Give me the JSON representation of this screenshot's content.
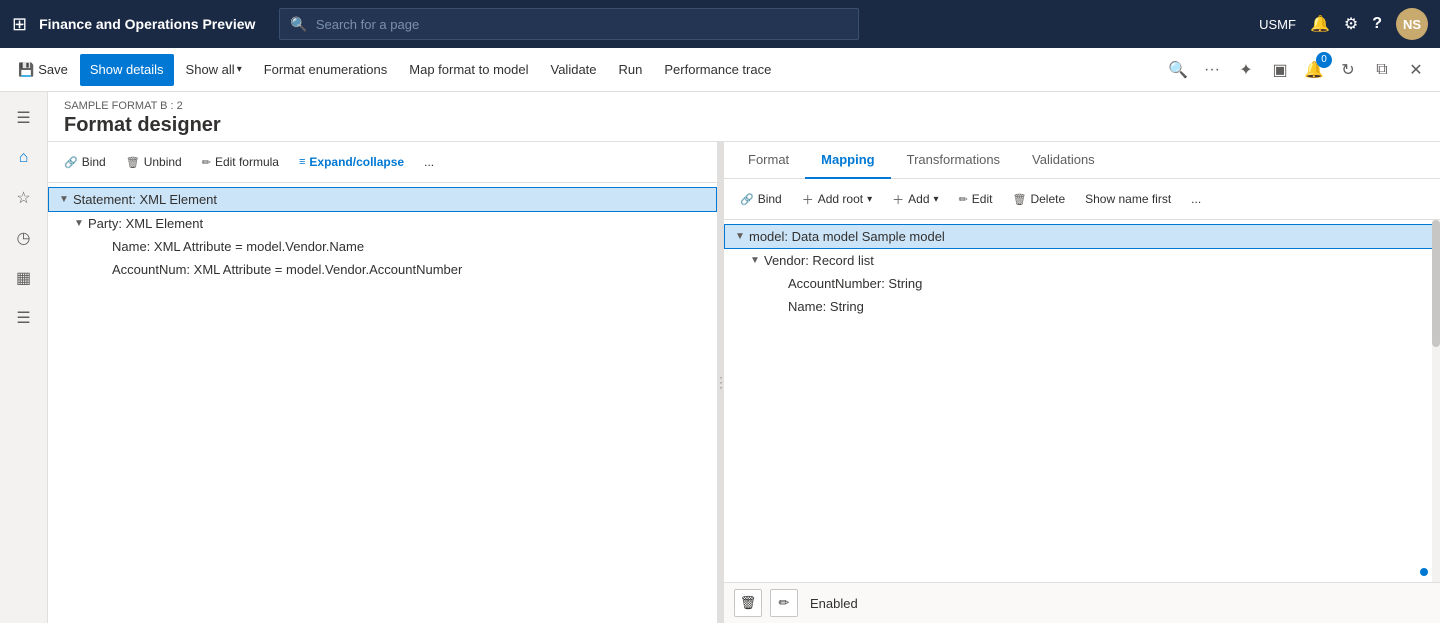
{
  "topnav": {
    "app_title": "Finance and Operations Preview",
    "search_placeholder": "Search for a page",
    "org": "USMF"
  },
  "commandbar": {
    "save_label": "Save",
    "show_details_label": "Show details",
    "show_all_label": "Show all",
    "format_enumerations_label": "Format enumerations",
    "map_format_label": "Map format to model",
    "validate_label": "Validate",
    "run_label": "Run",
    "performance_trace_label": "Performance trace"
  },
  "page": {
    "breadcrumb": "SAMPLE FORMAT B : 2",
    "title": "Format designer"
  },
  "left_pane": {
    "toolbar": {
      "bind_label": "Bind",
      "unbind_label": "Unbind",
      "edit_formula_label": "Edit formula",
      "expand_collapse_label": "Expand/collapse",
      "more_label": "..."
    },
    "tree": [
      {
        "id": "statement",
        "label": "Statement: XML Element",
        "indent": 0,
        "chevron": "▼",
        "selected": true
      },
      {
        "id": "party",
        "label": "Party: XML Element",
        "indent": 1,
        "chevron": "▼",
        "selected": false
      },
      {
        "id": "name",
        "label": "Name: XML Attribute = model.Vendor.Name",
        "indent": 2,
        "chevron": "",
        "selected": false
      },
      {
        "id": "accountnum",
        "label": "AccountNum: XML Attribute = model.Vendor.AccountNumber",
        "indent": 2,
        "chevron": "",
        "selected": false
      }
    ]
  },
  "right_pane": {
    "tabs": [
      {
        "id": "format",
        "label": "Format",
        "active": false
      },
      {
        "id": "mapping",
        "label": "Mapping",
        "active": true
      },
      {
        "id": "transformations",
        "label": "Transformations",
        "active": false
      },
      {
        "id": "validations",
        "label": "Validations",
        "active": false
      }
    ],
    "toolbar": {
      "bind_label": "Bind",
      "add_root_label": "Add root",
      "add_label": "Add",
      "edit_label": "Edit",
      "delete_label": "Delete",
      "show_name_first_label": "Show name first",
      "more_label": "..."
    },
    "tree": [
      {
        "id": "model",
        "label": "model: Data model Sample model",
        "indent": 0,
        "chevron": "▼",
        "selected": true
      },
      {
        "id": "vendor",
        "label": "Vendor: Record list",
        "indent": 1,
        "chevron": "▼",
        "selected": false
      },
      {
        "id": "accountnumber",
        "label": "AccountNumber: String",
        "indent": 2,
        "chevron": "",
        "selected": false
      },
      {
        "id": "namestr",
        "label": "Name: String",
        "indent": 2,
        "chevron": "",
        "selected": false
      }
    ],
    "bottom": {
      "enabled_label": "Enabled"
    }
  },
  "icons": {
    "grid": "⊞",
    "home": "⌂",
    "star": "☆",
    "recent": "◷",
    "table": "▦",
    "list": "☰",
    "funnel": "⊿",
    "search": "🔍",
    "bell": "🔔",
    "gear": "⚙",
    "help": "?",
    "save": "💾",
    "delete": "🗑",
    "edit": "✏",
    "add": "＋",
    "bind": "🔗",
    "unbind": "🗑",
    "expand": "≡",
    "chevron_down": "▾",
    "more": "···",
    "refresh": "↻",
    "newwindow": "⧉",
    "close": "✕",
    "pin": "📌",
    "palette": "🎨",
    "book": "📖"
  }
}
